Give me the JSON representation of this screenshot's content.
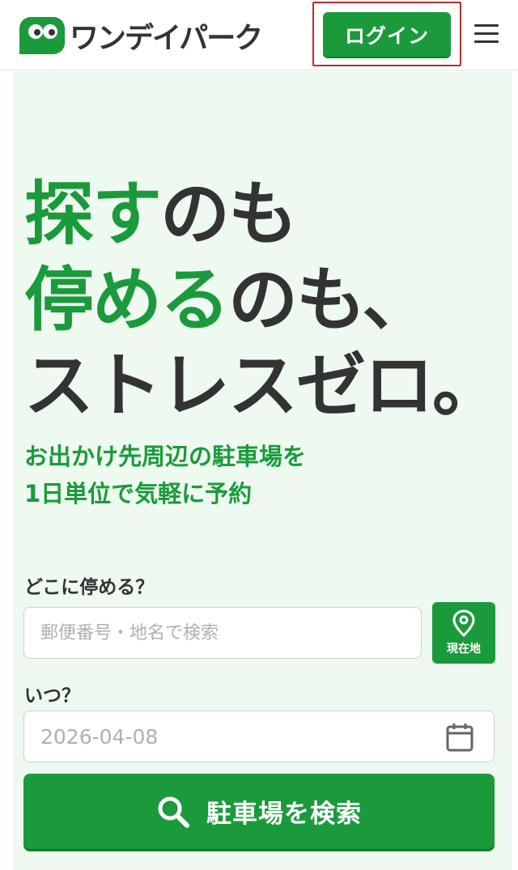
{
  "header": {
    "logo_text": "ワンデイパーク",
    "login_label": "ログイン"
  },
  "hero": {
    "headline": {
      "line1_green": "探す",
      "line1_dark": "のも",
      "line2_green": "停める",
      "line2_dark": "のも、",
      "line3": "ストレスゼロ。"
    },
    "subcopy_line1": "お出かけ先周辺の駐車場を",
    "subcopy_line2": "1日単位で気軽に予約"
  },
  "search_form": {
    "where_label": "どこに停める？",
    "where_placeholder": "郵便番号・地名で検索",
    "location_button_label": "現在地",
    "when_label": "いつ？",
    "date_value": "2026-04-08",
    "submit_label": "駐車場を検索"
  },
  "colors": {
    "brand_green": "#1b9a3c",
    "hero_background": "#eef9f0",
    "text_dark": "#333333",
    "highlight_frame": "#b4302a"
  },
  "icons": {
    "menu": "hamburger-icon",
    "location": "map-pin-icon",
    "calendar": "calendar-icon",
    "search": "search-icon"
  }
}
